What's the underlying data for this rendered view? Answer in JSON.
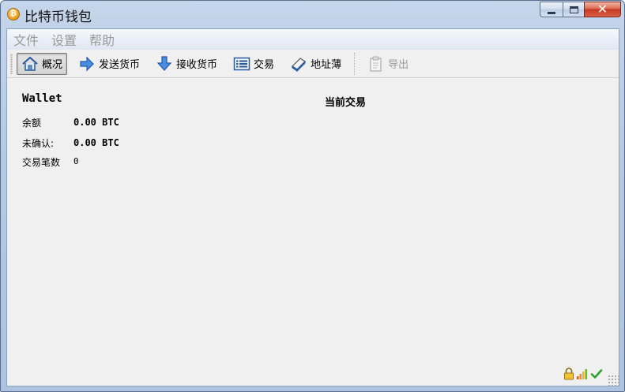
{
  "window": {
    "title": "比特币钱包",
    "app_icon_glyph": "₿"
  },
  "menubar": {
    "items": [
      "文件",
      "设置",
      "帮助"
    ]
  },
  "toolbar": {
    "overview_label": "概况",
    "send_label": "发送货币",
    "receive_label": "接收货币",
    "transactions_label": "交易",
    "address_book_label": "地址薄",
    "export_label": "导出",
    "icons": {
      "overview": "home-icon",
      "send": "arrow-right-icon",
      "receive": "arrow-down-icon",
      "transactions": "list-icon",
      "address_book": "address-book-icon",
      "export": "export-icon"
    }
  },
  "overview": {
    "wallet_title": "Wallet",
    "balance_label": "余额",
    "balance_value": "0.00 BTC",
    "unconfirmed_label": "未确认:",
    "unconfirmed_value": "0.00 BTC",
    "tx_count_label": "交易笔数",
    "tx_count_value": "0",
    "recent_title": "当前交易"
  },
  "statusbar": {
    "icons": [
      "lock-icon",
      "signal-icon",
      "check-icon"
    ]
  },
  "colors": {
    "accent": "#2f6fc0",
    "close_button": "#c4381e",
    "check": "#2ea02e"
  }
}
